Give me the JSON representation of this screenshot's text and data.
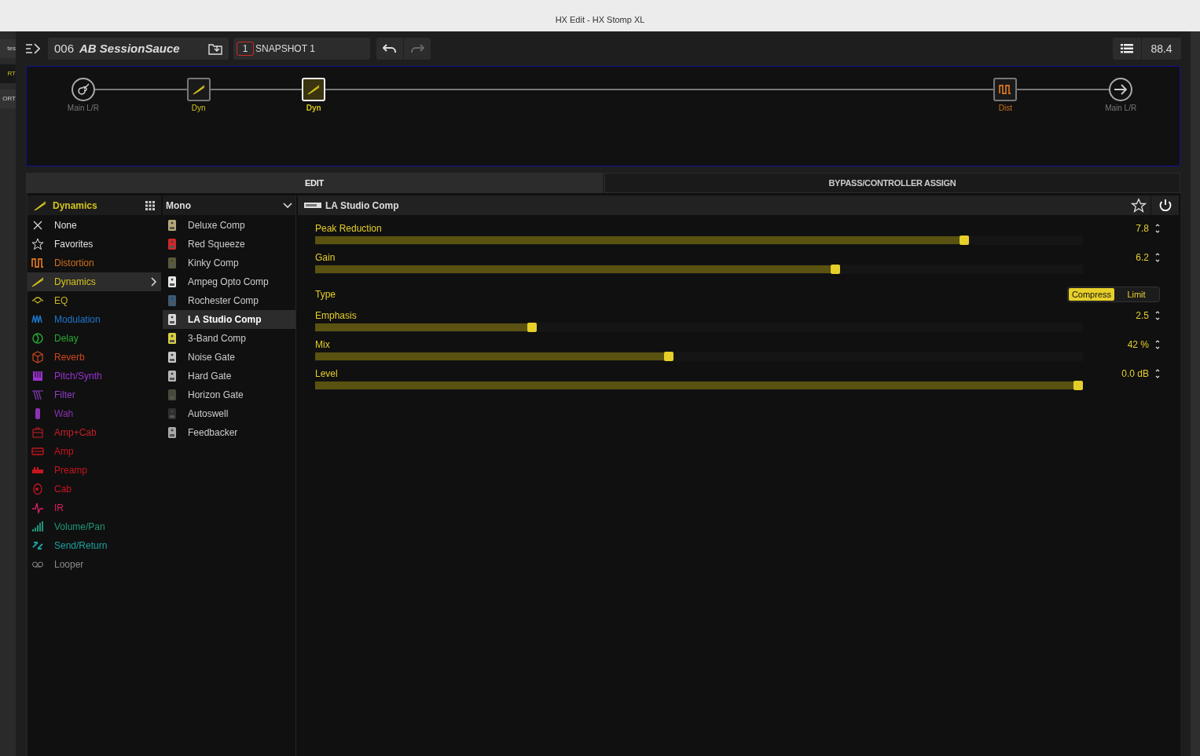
{
  "window": {
    "title": "HX Edit - HX Stomp XL"
  },
  "left_edge": {
    "items": [
      {
        "label": "tes",
        "selected": false
      },
      {
        "label": "RT",
        "selected": true
      },
      {
        "label": "ORT",
        "selected": false
      }
    ]
  },
  "toolbar": {
    "preset_number": "006",
    "preset_name": "AB SessionSauce",
    "snapshot_number": "1",
    "snapshot": "SNAPSHOT 1",
    "redo_disabled": true,
    "tempo": "88.4"
  },
  "signal_chain": [
    {
      "kind": "input",
      "label": "Main L/R",
      "selected": false
    },
    {
      "kind": "dynamics",
      "label": "Dyn",
      "color": "#d4c21e",
      "selected": false
    },
    {
      "kind": "dynamics",
      "label": "Dyn",
      "color": "#d4c21e",
      "selected": true
    },
    {
      "kind": "distortion",
      "label": "Dist",
      "color": "#d0701e",
      "selected": false
    },
    {
      "kind": "output",
      "label": "Main L/R",
      "selected": false
    }
  ],
  "tabs": [
    {
      "label": "EDIT",
      "selected": true
    },
    {
      "label": "BYPASS/CONTROLLER ASSIGN",
      "selected": false
    }
  ],
  "category_header": "Dynamics",
  "categories": [
    {
      "kind": "none",
      "label": "None",
      "color": "#e0e0e0",
      "selected": false
    },
    {
      "kind": "favorites",
      "label": "Favorites",
      "color": "#e0e0e0",
      "selected": false
    },
    {
      "kind": "distortion",
      "label": "Distortion",
      "color": "#d0701e",
      "selected": false
    },
    {
      "kind": "dynamics",
      "label": "Dynamics",
      "color": "#d4c21e",
      "selected": true
    },
    {
      "kind": "eq",
      "label": "EQ",
      "color": "#c8b428",
      "selected": false
    },
    {
      "kind": "modulation",
      "label": "Modulation",
      "color": "#1e78d0",
      "selected": false
    },
    {
      "kind": "delay",
      "label": "Delay",
      "color": "#28a832",
      "selected": false
    },
    {
      "kind": "reverb",
      "label": "Reverb",
      "color": "#d0461e",
      "selected": false
    },
    {
      "kind": "pitch",
      "label": "Pitch/Synth",
      "color": "#9a32d0",
      "selected": false
    },
    {
      "kind": "filter",
      "label": "Filter",
      "color": "#8c3cc8",
      "selected": false
    },
    {
      "kind": "wah",
      "label": "Wah",
      "color": "#8c32b4",
      "selected": false
    },
    {
      "kind": "ampcab",
      "label": "Amp+Cab",
      "color": "#c81e28",
      "selected": false
    },
    {
      "kind": "amp",
      "label": "Amp",
      "color": "#c8141e",
      "selected": false
    },
    {
      "kind": "preamp",
      "label": "Preamp",
      "color": "#c8141e",
      "selected": false
    },
    {
      "kind": "cab",
      "label": "Cab",
      "color": "#c8141e",
      "selected": false
    },
    {
      "kind": "ir",
      "label": "IR",
      "color": "#dc1e64",
      "selected": false
    },
    {
      "kind": "volume",
      "label": "Volume/Pan",
      "color": "#1e9678",
      "selected": false
    },
    {
      "kind": "send",
      "label": "Send/Return",
      "color": "#1ea0a0",
      "selected": false
    },
    {
      "kind": "looper",
      "label": "Looper",
      "color": "#8a8a8a",
      "selected": false
    }
  ],
  "model_header": "Mono",
  "models": [
    {
      "label": "Deluxe Comp",
      "color": "#b8a878",
      "selected": false
    },
    {
      "label": "Red Squeeze",
      "color": "#d02828",
      "selected": false
    },
    {
      "label": "Kinky Comp",
      "color": "#5a5a3a",
      "selected": false
    },
    {
      "label": "Ampeg Opto Comp",
      "color": "#e8e8e8",
      "selected": false
    },
    {
      "label": "Rochester Comp",
      "color": "#3a5a78",
      "selected": false
    },
    {
      "label": "LA Studio Comp",
      "color": "#d8d8d8",
      "selected": true
    },
    {
      "label": "3-Band Comp",
      "color": "#d8d040",
      "selected": false
    },
    {
      "label": "Noise Gate",
      "color": "#c8c8c8",
      "selected": false
    },
    {
      "label": "Hard Gate",
      "color": "#b8b8b8",
      "selected": false
    },
    {
      "label": "Horizon Gate",
      "color": "#4a4a3a",
      "selected": false
    },
    {
      "label": "Autoswell",
      "color": "#303030",
      "selected": false
    },
    {
      "label": "Feedbacker",
      "color": "#a8a8a8",
      "selected": false
    }
  ],
  "model_panel": {
    "title": "LA Studio Comp",
    "enabled": true,
    "params": [
      {
        "kind": "slider",
        "label": "Peak Reduction",
        "value": "7.8",
        "level": 0.85
      },
      {
        "kind": "slider",
        "label": "Gain",
        "value": "6.2",
        "level": 0.68
      },
      {
        "kind": "toggle",
        "label": "Type",
        "options": [
          {
            "label": "Compress",
            "selected": true
          },
          {
            "label": "Limit",
            "selected": false
          }
        ]
      },
      {
        "kind": "slider",
        "label": "Emphasis",
        "value": "2.5",
        "level": 0.28
      },
      {
        "kind": "slider",
        "label": "Mix",
        "value": "42 %",
        "level": 0.46
      },
      {
        "kind": "slider",
        "label": "Level",
        "value": "0.0 dB",
        "level": 1
      }
    ]
  }
}
